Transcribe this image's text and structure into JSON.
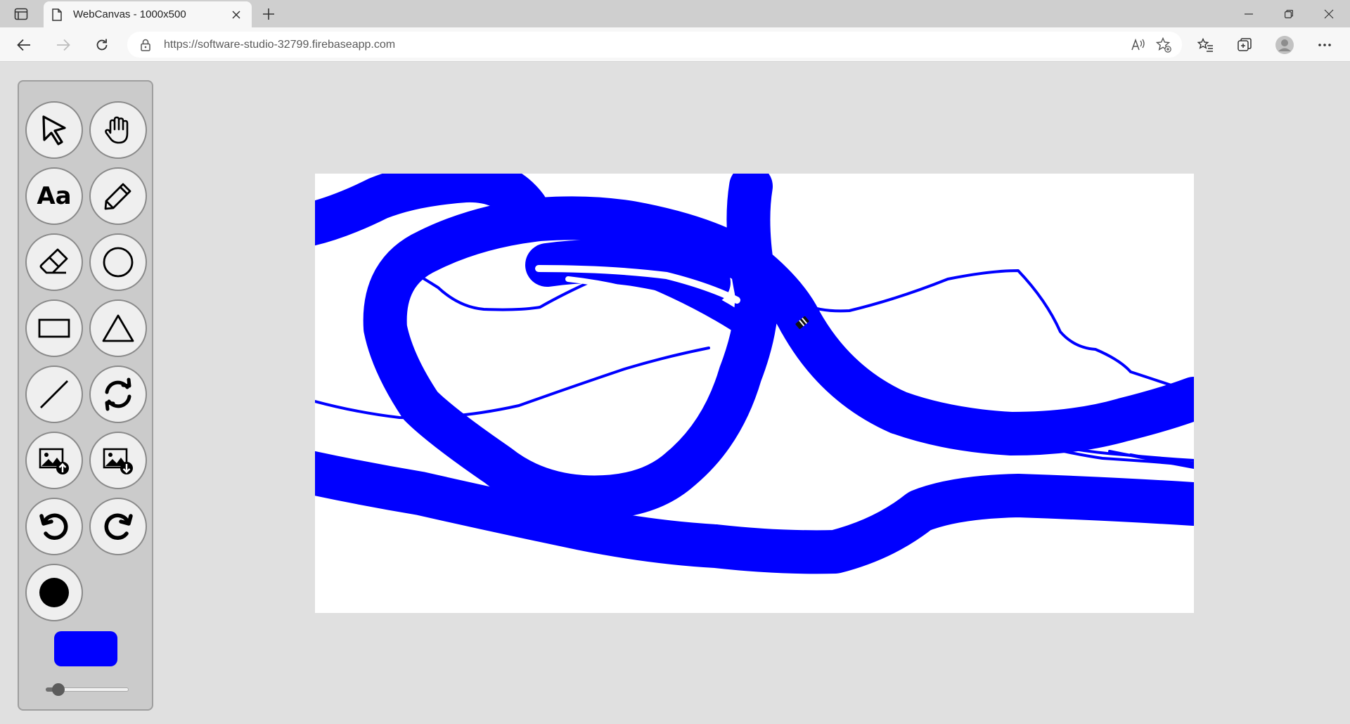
{
  "browser": {
    "tab_title": "WebCanvas - 1000x500",
    "url": "https://software-studio-32799.firebaseapp.com"
  },
  "tools": [
    {
      "id": "select",
      "icon": "cursor-arrow-icon"
    },
    {
      "id": "pan",
      "icon": "hand-icon"
    },
    {
      "id": "text",
      "icon": "text-tool-icon",
      "label": "Aa"
    },
    {
      "id": "pencil",
      "icon": "pencil-icon"
    },
    {
      "id": "eraser",
      "icon": "eraser-icon"
    },
    {
      "id": "circle",
      "icon": "circle-icon"
    },
    {
      "id": "rectangle",
      "icon": "rectangle-icon"
    },
    {
      "id": "triangle",
      "icon": "triangle-icon"
    },
    {
      "id": "line",
      "icon": "line-icon"
    },
    {
      "id": "reset",
      "icon": "refresh-icon"
    },
    {
      "id": "upload-image",
      "icon": "image-upload-icon"
    },
    {
      "id": "download-image",
      "icon": "image-download-icon"
    },
    {
      "id": "undo",
      "icon": "undo-icon"
    },
    {
      "id": "redo",
      "icon": "redo-icon"
    },
    {
      "id": "brush-shape",
      "icon": "filled-circle-icon"
    }
  ],
  "brush": {
    "color": "#0000ff",
    "size_level": 0.15
  },
  "canvas": {
    "background": "#ffffff",
    "stroke_color": "#0000ff"
  }
}
